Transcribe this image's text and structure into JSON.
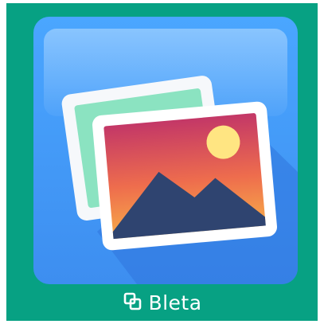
{
  "app": {
    "icon_name": "gallery-photos-icon",
    "brand_name": "Bleta",
    "brand_logo_icon": "overlapping-squares-icon"
  },
  "colors": {
    "tile_background": "#07a183",
    "icon_background": "#3f8ff2",
    "photo_frame": "#ffffff",
    "back_photo": "#8be3c1",
    "sky_top": "#c63a63",
    "sky_bottom": "#f6a44b",
    "sun": "#ffe582",
    "mountain": "#2f4470",
    "brand_text": "#ffffff"
  }
}
